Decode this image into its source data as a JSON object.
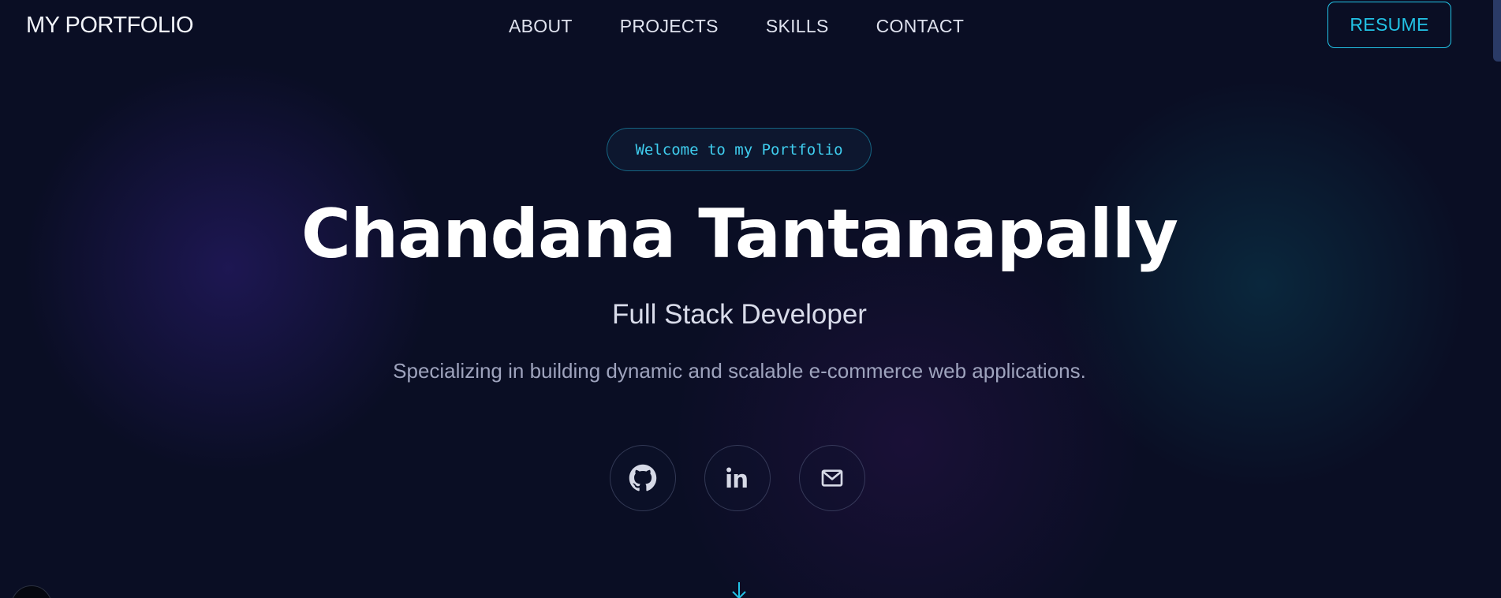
{
  "nav": {
    "brand": "MY PORTFOLIO",
    "links": [
      "ABOUT",
      "PROJECTS",
      "SKILLS",
      "CONTACT"
    ],
    "resume_label": "RESUME"
  },
  "hero": {
    "badge": "Welcome to my Portfolio",
    "name": "Chandana Tantanapally",
    "role": "Full Stack Developer",
    "description": "Specializing in building dynamic and scalable e-commerce web applications."
  },
  "socials": [
    {
      "icon": "github-icon"
    },
    {
      "icon": "linkedin-icon"
    },
    {
      "icon": "mail-icon"
    }
  ],
  "colors": {
    "accent": "#22c3e6",
    "background": "#0a0e24"
  }
}
